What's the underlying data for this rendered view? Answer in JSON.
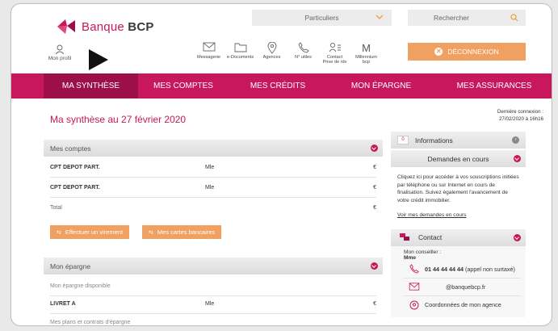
{
  "header": {
    "brand": "Banque",
    "brand_bold": "BCP",
    "profile_label": "Mon profil",
    "segment_select": "Particuliers",
    "search_placeholder": "Rechercher",
    "icons": [
      {
        "label": "Messagerie",
        "icon": "envelope-icon"
      },
      {
        "label": "e-Documents",
        "icon": "folder-icon"
      },
      {
        "label": "Agences",
        "icon": "location-pin-icon"
      },
      {
        "label": "N° utiles",
        "icon": "phone-icon"
      },
      {
        "label": "Contact",
        "label2": "Prise de rdv",
        "icon": "contact-icon"
      },
      {
        "label": "Millennium",
        "label2": "bcp",
        "icon": "millennium-m-icon",
        "glyph": "M"
      }
    ],
    "logout_label": "DÉCONNEXION"
  },
  "nav": {
    "tabs": [
      "MA SYNTHÈSE",
      "MES COMPTES",
      "MES CRÉDITS",
      "MON ÉPARGNE",
      "MES ASSURANCES"
    ],
    "active": 0
  },
  "main": {
    "title": "Ma synthèse au 27 février 2020",
    "last_connection_label": "Dernière connexion :",
    "last_connection_value": "27/02/2020 à 16h16",
    "accounts_section": "Mes comptes",
    "accounts": [
      {
        "name": "CPT DEPOT PART.",
        "holder": "Mle",
        "amount": "€"
      },
      {
        "name": "CPT DEPOT PART.",
        "holder": "Mle",
        "amount": "€"
      }
    ],
    "total_label": "Total",
    "total_amount": "€",
    "btn_transfer": "Effectuer un virement",
    "btn_cards": "Mes cartes bancaires",
    "savings_section": "Mon épargne",
    "savings_available": "Mon épargne disponible",
    "livret": {
      "name": "LIVRET A",
      "holder": "Mle",
      "amount": "€"
    },
    "savings_plans": "Mes plans et contrats d'épargne"
  },
  "sidebar": {
    "info_badge": "0",
    "info_label": "Informations",
    "requests_label": "Demandes en cours",
    "requests_text": "Cliquez ici pour accéder à vos souscriptions initiées par téléphone ou sur Internet en cours de finalisation. Suivez également l'avancement de votre crédit immobilier.",
    "requests_link": "Voir mes demandes en cours",
    "contact_label": "Contact",
    "advisor_label": "Mon conseiller :",
    "advisor_name": "Mme",
    "phone_number": "01 44 44 44 44",
    "phone_note": "(appel non surtaxé)",
    "email": "@banquebcp.fr",
    "agency_link": "Coordonnées de mon agence"
  },
  "colors": {
    "brand": "#c8175d",
    "accent": "#f0a060",
    "nav_active": "#9d0f49"
  }
}
